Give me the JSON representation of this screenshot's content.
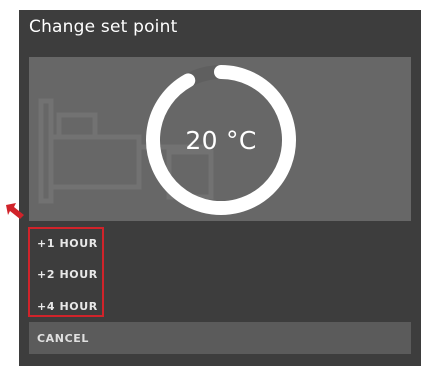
{
  "dialog": {
    "title": "Change set point",
    "setpoint": {
      "value_label": "20 °C",
      "ring_fraction": 0.92
    },
    "options": [
      {
        "label": "+1 HOUR"
      },
      {
        "label": "+2 HOUR"
      },
      {
        "label": "+4 HOUR"
      }
    ],
    "cancel_label": "CANCEL"
  },
  "colors": {
    "dialog_bg": "#3d3d3d",
    "panel_bg": "#676767",
    "ring": "#ffffff",
    "highlight": "#d1232a"
  },
  "icons": {
    "background_art": "bed-icon",
    "annotation_arrow": "red-arrow-icon"
  }
}
